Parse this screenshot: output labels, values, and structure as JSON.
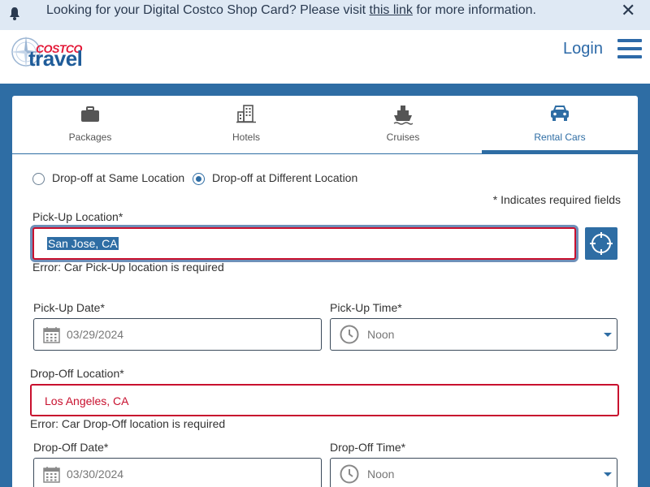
{
  "banner": {
    "msg_before": "Looking for your Digital Costco Shop Card? Please visit ",
    "link_text": "this link",
    "msg_after": " for more information."
  },
  "header": {
    "logo_top": "COSTCO",
    "logo_bottom": "travel",
    "login_label": "Login"
  },
  "tabs": [
    {
      "label": "Packages",
      "icon": "suitcase-icon"
    },
    {
      "label": "Hotels",
      "icon": "building-icon"
    },
    {
      "label": "Cruises",
      "icon": "ship-icon"
    },
    {
      "label": "Rental Cars",
      "icon": "car-icon",
      "active": true
    }
  ],
  "form": {
    "radio_same": "Drop-off at Same Location",
    "radio_different": "Drop-off at Different Location",
    "selected_radio": "different",
    "required_note": "* Indicates required fields",
    "pickup_location_label": "Pick-Up Location*",
    "pickup_location_value": "San Jose, CA",
    "pickup_location_error": "Error: Car Pick-Up location is required",
    "pickup_date_label": "Pick-Up Date*",
    "pickup_date_value": "03/29/2024",
    "pickup_time_label": "Pick-Up Time*",
    "pickup_time_value": "Noon",
    "dropoff_location_label": "Drop-Off Location*",
    "dropoff_location_value": "Los Angeles, CA",
    "dropoff_location_error": "Error: Car Drop-Off location is required",
    "dropoff_date_label": "Drop-Off Date*",
    "dropoff_date_value": "03/30/2024",
    "dropoff_time_label": "Drop-Off Time*",
    "dropoff_time_value": "Noon"
  },
  "colors": {
    "brand_blue": "#2e6da4",
    "error_red": "#c8102e",
    "banner_bg": "#dfe9f4"
  }
}
